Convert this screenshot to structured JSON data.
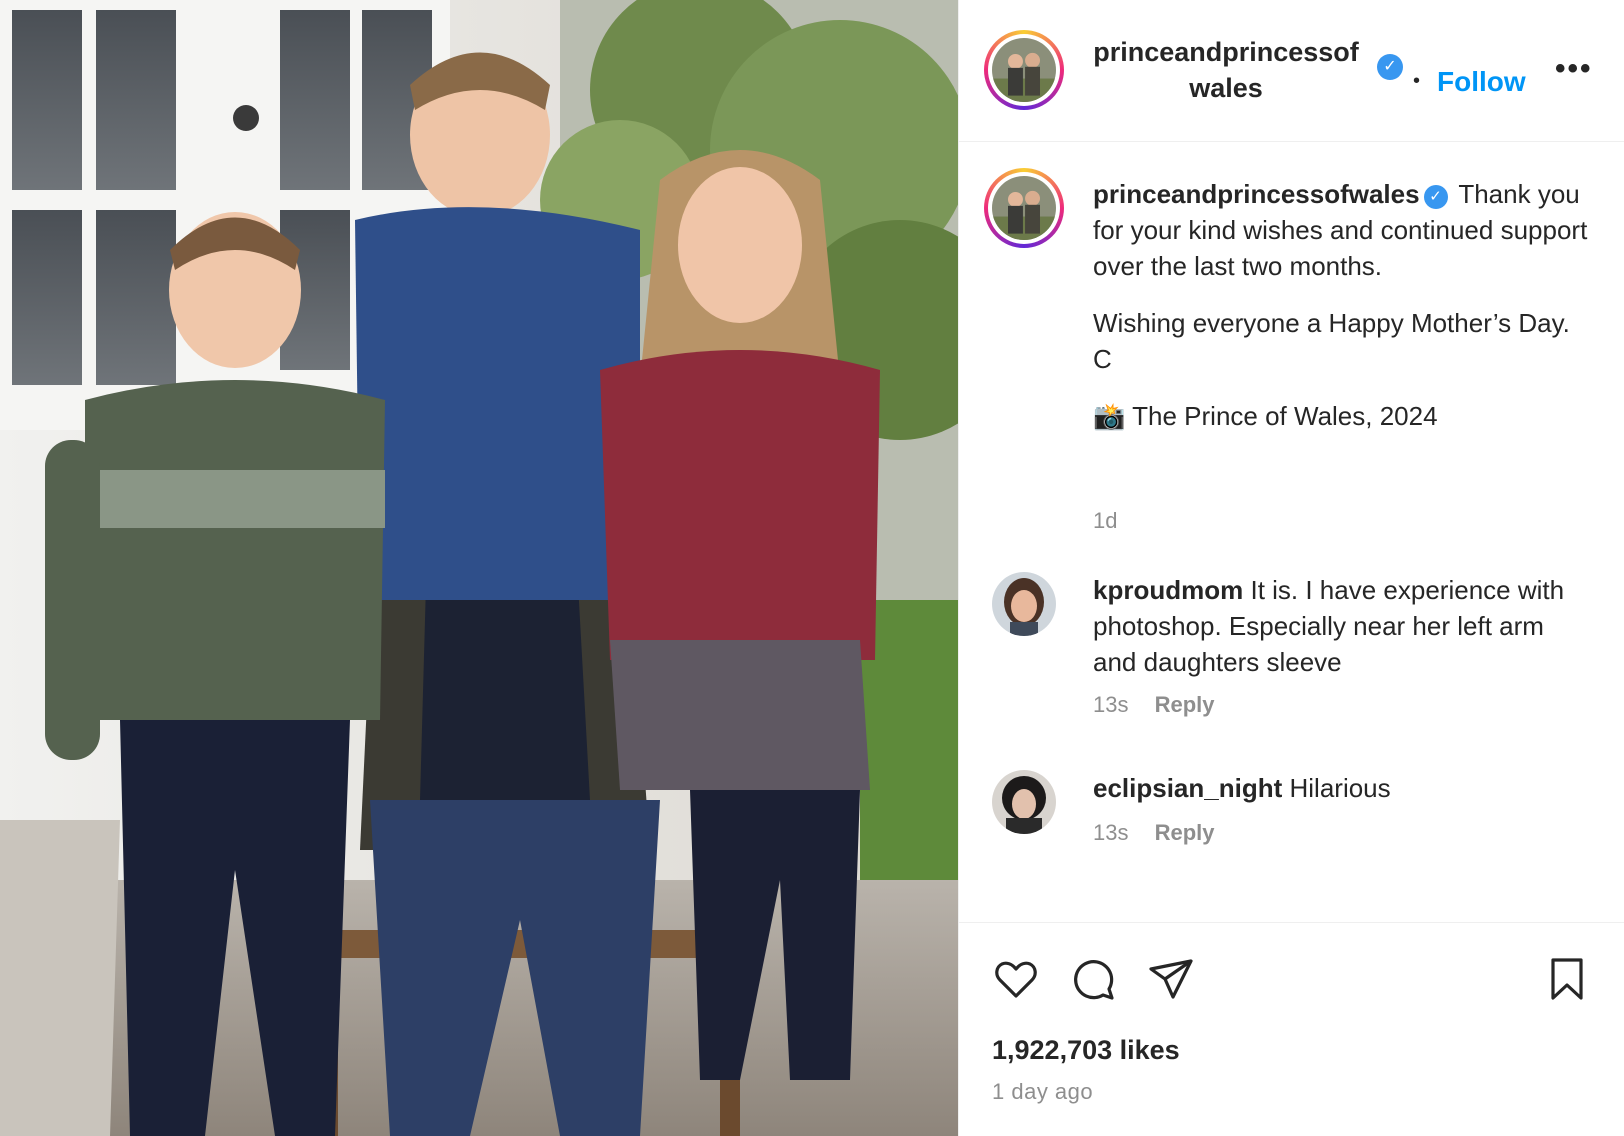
{
  "post": {
    "username": "princeandprincessofwales",
    "username_line1": "princeandprincessof",
    "username_line2": "wales",
    "verified_glyph": "✓",
    "separator": "•",
    "follow_label": "Follow",
    "more_label": "•••"
  },
  "caption": {
    "username": "princeandprincessofwales",
    "text_1": "Thank you for your kind wishes and continued support over the last two months.",
    "text_2": "Wishing everyone a Happy Mother’s Day. C",
    "camera_emoji": "📸",
    "text_3": "The Prince of Wales, 2024",
    "time": "1d"
  },
  "comments": [
    {
      "username": "kproudmom",
      "text": "It is. I have experience with photoshop. Especially near her left arm and daughters sleeve",
      "time": "13s",
      "reply_label": "Reply"
    },
    {
      "username": "eclipsian_night",
      "text": "Hilarious",
      "time": "13s",
      "reply_label": "Reply"
    }
  ],
  "actions": {
    "icons": [
      "heart-icon",
      "comment-icon",
      "share-icon",
      "bookmark-icon"
    ],
    "likes": "1,922,703 likes",
    "posted": "1 day ago"
  },
  "colors": {
    "follow": "#0095f6",
    "verified": "#3897f0",
    "secondary_text": "#8e8e8e",
    "primary_text": "#262626"
  }
}
